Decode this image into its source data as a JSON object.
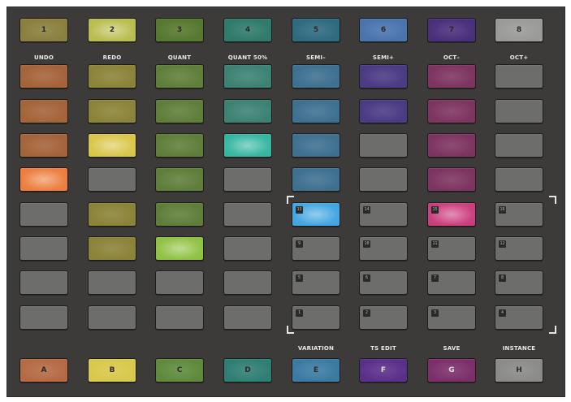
{
  "top_buttons": [
    {
      "label": "1",
      "color": "#8a7f3e"
    },
    {
      "label": "2",
      "color": "#b7bb48"
    },
    {
      "label": "3",
      "color": "#56782f"
    },
    {
      "label": "4",
      "color": "#2f7a6a"
    },
    {
      "label": "5",
      "color": "#2e6a80"
    },
    {
      "label": "6",
      "color": "#4a74ae"
    },
    {
      "label": "7",
      "color": "#4a2f7c"
    },
    {
      "label": "8",
      "color": "#9a9a98"
    }
  ],
  "column_labels": [
    "UNDO",
    "REDO",
    "QUANT",
    "QUANT 50%",
    "SEMI–",
    "SEMI+",
    "OCT–",
    "OCT+"
  ],
  "grid": [
    [
      {
        "s": "dim",
        "c": "#a4633a"
      },
      {
        "s": "dim",
        "c": "#8b8338"
      },
      {
        "s": "dim",
        "c": "#5f7e3a"
      },
      {
        "s": "dim",
        "c": "#3c8273"
      },
      {
        "s": "dim",
        "c": "#3e7090"
      },
      {
        "s": "dim",
        "c": "#4b3a84"
      },
      {
        "s": "dim",
        "c": "#7d3460"
      },
      {
        "s": "off"
      }
    ],
    [
      {
        "s": "dim",
        "c": "#a4633a"
      },
      {
        "s": "dim",
        "c": "#8b8338"
      },
      {
        "s": "dim",
        "c": "#5f7e3a"
      },
      {
        "s": "dim",
        "c": "#3c8273"
      },
      {
        "s": "dim",
        "c": "#3e7090"
      },
      {
        "s": "dim",
        "c": "#4b3a84"
      },
      {
        "s": "dim",
        "c": "#7d3460"
      },
      {
        "s": "off"
      }
    ],
    [
      {
        "s": "dim",
        "c": "#a4633a"
      },
      {
        "s": "bright",
        "c": "#d8c442"
      },
      {
        "s": "dim",
        "c": "#5f7e3a"
      },
      {
        "s": "bright",
        "c": "#2fb49e"
      },
      {
        "s": "dim",
        "c": "#3e7090"
      },
      {
        "s": "off"
      },
      {
        "s": "dim",
        "c": "#7d3460"
      },
      {
        "s": "off"
      }
    ],
    [
      {
        "s": "bright",
        "c": "#ec7a38"
      },
      {
        "s": "off"
      },
      {
        "s": "dim",
        "c": "#5f7e3a"
      },
      {
        "s": "off"
      },
      {
        "s": "dim",
        "c": "#3e7090"
      },
      {
        "s": "off"
      },
      {
        "s": "dim",
        "c": "#7d3460"
      },
      {
        "s": "off"
      }
    ],
    [
      {
        "s": "off"
      },
      {
        "s": "dim",
        "c": "#8b8338"
      },
      {
        "s": "dim",
        "c": "#5f7e3a"
      },
      {
        "s": "off"
      },
      {
        "s": "bright",
        "c": "#3ea3e0",
        "t": "13"
      },
      {
        "s": "off",
        "t": "14"
      },
      {
        "s": "bright",
        "c": "#c9387a",
        "t": "15"
      },
      {
        "s": "off",
        "t": "16"
      }
    ],
    [
      {
        "s": "off"
      },
      {
        "s": "dim",
        "c": "#8b8338"
      },
      {
        "s": "bright",
        "c": "#8cc03c"
      },
      {
        "s": "off"
      },
      {
        "s": "off",
        "t": "9"
      },
      {
        "s": "off",
        "t": "10"
      },
      {
        "s": "off",
        "t": "11"
      },
      {
        "s": "off",
        "t": "12"
      }
    ],
    [
      {
        "s": "off"
      },
      {
        "s": "off"
      },
      {
        "s": "off"
      },
      {
        "s": "off"
      },
      {
        "s": "off",
        "t": "5"
      },
      {
        "s": "off",
        "t": "6"
      },
      {
        "s": "off",
        "t": "7"
      },
      {
        "s": "off",
        "t": "8"
      }
    ],
    [
      {
        "s": "off"
      },
      {
        "s": "off"
      },
      {
        "s": "off"
      },
      {
        "s": "off"
      },
      {
        "s": "off",
        "t": "1"
      },
      {
        "s": "off",
        "t": "2"
      },
      {
        "s": "off",
        "t": "3"
      },
      {
        "s": "off",
        "t": "4"
      }
    ]
  ],
  "bottom_labels": [
    "",
    "",
    "",
    "",
    "VARIATION",
    "TS EDIT",
    "SAVE",
    "INSTANCE"
  ],
  "bottom_buttons": [
    {
      "label": "A",
      "color": "#b56a44"
    },
    {
      "label": "B",
      "color": "#d8c84c"
    },
    {
      "label": "C",
      "color": "#5f8a3c"
    },
    {
      "label": "D",
      "color": "#2f7e73"
    },
    {
      "label": "E",
      "color": "#3c7aa2"
    },
    {
      "label": "F",
      "color": "#5a2f8a"
    },
    {
      "label": "G",
      "color": "#7c2f6a"
    },
    {
      "label": "H",
      "color": "#8a8a88"
    }
  ]
}
